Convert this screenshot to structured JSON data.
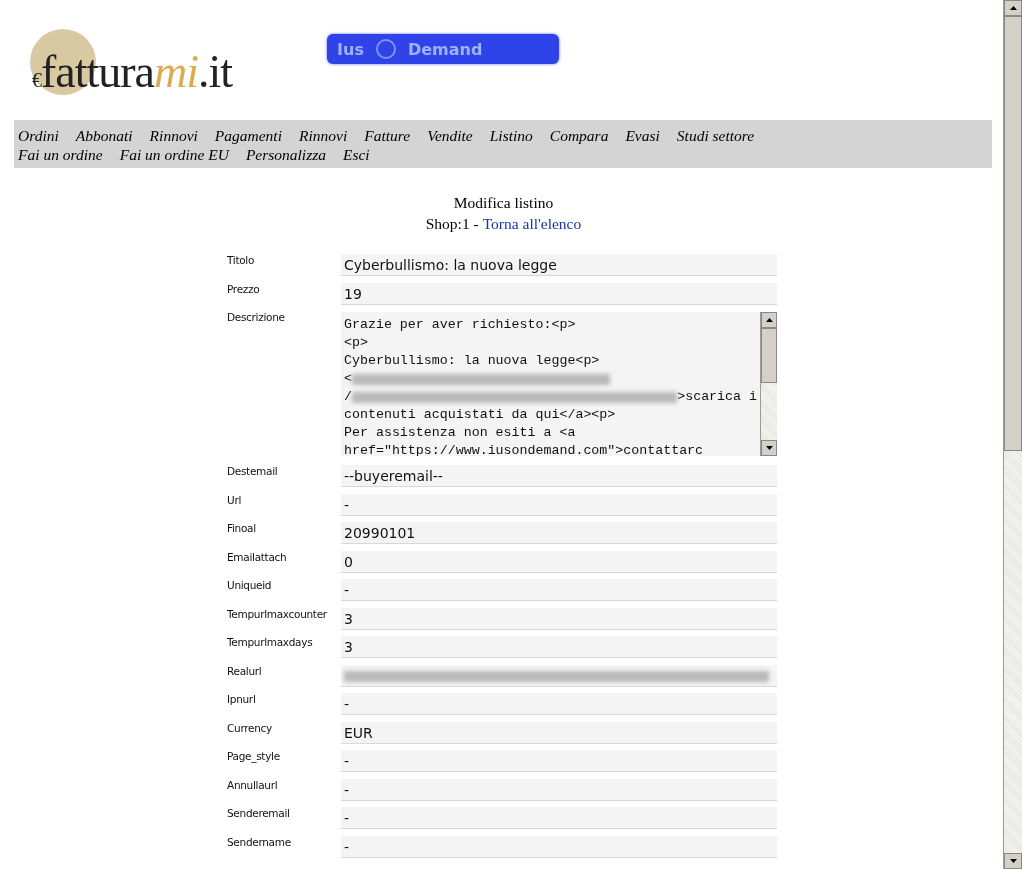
{
  "logo": {
    "currency": "€",
    "main": "fattura",
    "accent": "mi",
    "suffix": ".it"
  },
  "banner": {
    "left": "Ius",
    "right": "Demand"
  },
  "nav": [
    "Ordini",
    "Abbonati",
    "Rinnovi",
    "Pagamenti",
    "Rinnovi",
    "Fatture",
    "Vendite",
    "Listino",
    "Compara",
    "Evasi",
    "Studi settore",
    "Fai un ordine",
    "Fai un ordine EU",
    "Personalizza",
    "Esci"
  ],
  "heading": {
    "title": "Modifica listino",
    "shop": "Shop:1 -",
    "back_link": "Torna all'elenco"
  },
  "fields": [
    {
      "label": "Titolo",
      "kind": "text",
      "value": "Cyberbullismo: la nuova legge"
    },
    {
      "label": "Prezzo",
      "kind": "text",
      "value": "19"
    },
    {
      "label": "Descrizione",
      "kind": "textarea",
      "lines": [
        [
          {
            "kind": "text",
            "text": "Grazie per aver richiesto:<p>"
          }
        ],
        [
          {
            "kind": "text",
            "text": "<p>"
          }
        ],
        [
          {
            "kind": "text",
            "text": "Cyberbullismo: la nuova legge<p>"
          }
        ],
        [
          {
            "kind": "text",
            "text": "<"
          },
          {
            "kind": "redacted"
          }
        ],
        [
          {
            "kind": "text",
            "text": "/"
          },
          {
            "kind": "redacted"
          },
          {
            "kind": "text",
            "text": ">scarica i"
          }
        ],
        [
          {
            "kind": "text",
            "text": "contenuti acquistati da qui</a><p>"
          }
        ],
        [
          {
            "kind": "text",
            "text": "Per assistenza non esiti a <a"
          }
        ],
        [
          {
            "kind": "text",
            "text": "href=\"https://www.iusondemand.com\">contattarc"
          }
        ]
      ]
    },
    {
      "label": "Destemail",
      "kind": "text",
      "value": "--buyeremail--"
    },
    {
      "label": "Url",
      "kind": "text",
      "value": "-"
    },
    {
      "label": "Finoal",
      "kind": "text",
      "value": "20990101"
    },
    {
      "label": "Emailattach",
      "kind": "text",
      "value": "0"
    },
    {
      "label": "Uniqueid",
      "kind": "text",
      "value": "-"
    },
    {
      "label": "Tempurlmaxcounter",
      "kind": "text",
      "value": "3"
    },
    {
      "label": "Tempurlmaxdays",
      "kind": "text",
      "value": "3"
    },
    {
      "label": "Realurl",
      "kind": "redacted"
    },
    {
      "label": "Ipnurl",
      "kind": "text",
      "value": "-"
    },
    {
      "label": "Currency",
      "kind": "text",
      "value": "EUR"
    },
    {
      "label": "Page_style",
      "kind": "text",
      "value": "-"
    },
    {
      "label": "Annullaurl",
      "kind": "text",
      "value": "-"
    },
    {
      "label": "Senderemail",
      "kind": "text",
      "value": "-"
    },
    {
      "label": "Sendername",
      "kind": "text",
      "value": "-"
    }
  ]
}
